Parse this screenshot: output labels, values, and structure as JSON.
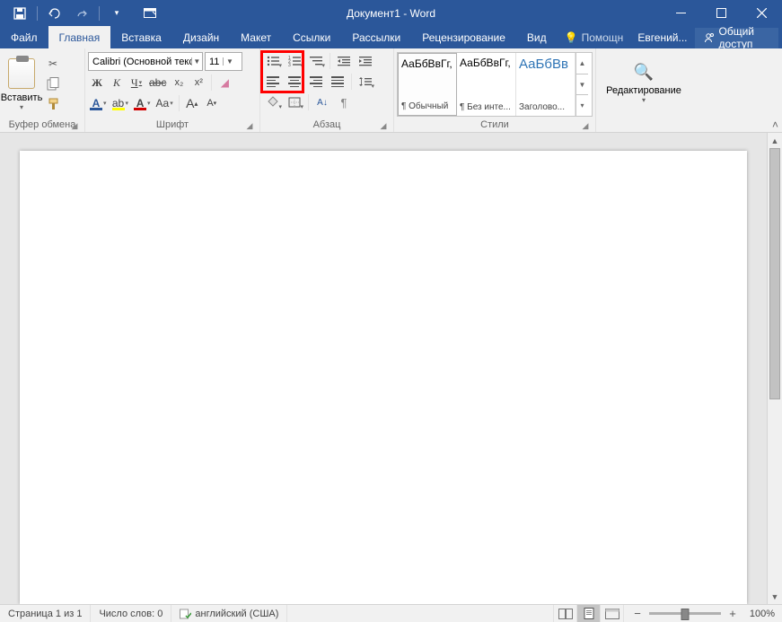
{
  "title": "Документ1 - Word",
  "tabs": {
    "file": "Файл",
    "home": "Главная",
    "insert": "Вставка",
    "design": "Дизайн",
    "layout": "Макет",
    "references": "Ссылки",
    "mailings": "Рассылки",
    "review": "Рецензирование",
    "view": "Вид"
  },
  "tellme": "Помощн",
  "user": "Евгений...",
  "share": "Общий доступ",
  "groups": {
    "clipboard": "Буфер обмена",
    "font": "Шрифт",
    "paragraph": "Абзац",
    "styles": "Стили",
    "editing": "Редактирование"
  },
  "clipboard": {
    "paste": "Вставить"
  },
  "font": {
    "name": "Calibri (Основной текст)",
    "size": "11",
    "bold": "Ж",
    "italic": "К",
    "underline": "Ч",
    "strike": "abc",
    "sub": "x₂",
    "sup": "x²",
    "effects": "A",
    "highlight": "ab",
    "color": "A",
    "case": "Aa",
    "grow": "A",
    "shrink": "A",
    "clear": "🧽"
  },
  "para": {
    "sort": "А↓",
    "show": "¶"
  },
  "styles": [
    {
      "sample": "АаБбВвГг,",
      "name": "¶ Обычный"
    },
    {
      "sample": "АаБбВвГг,",
      "name": "¶ Без инте..."
    },
    {
      "sample": "АаБбВв",
      "name": "Заголово..."
    }
  ],
  "status": {
    "page": "Страница 1 из 1",
    "words": "Число слов: 0",
    "lang": "английский (США)",
    "zoom": "100%"
  }
}
